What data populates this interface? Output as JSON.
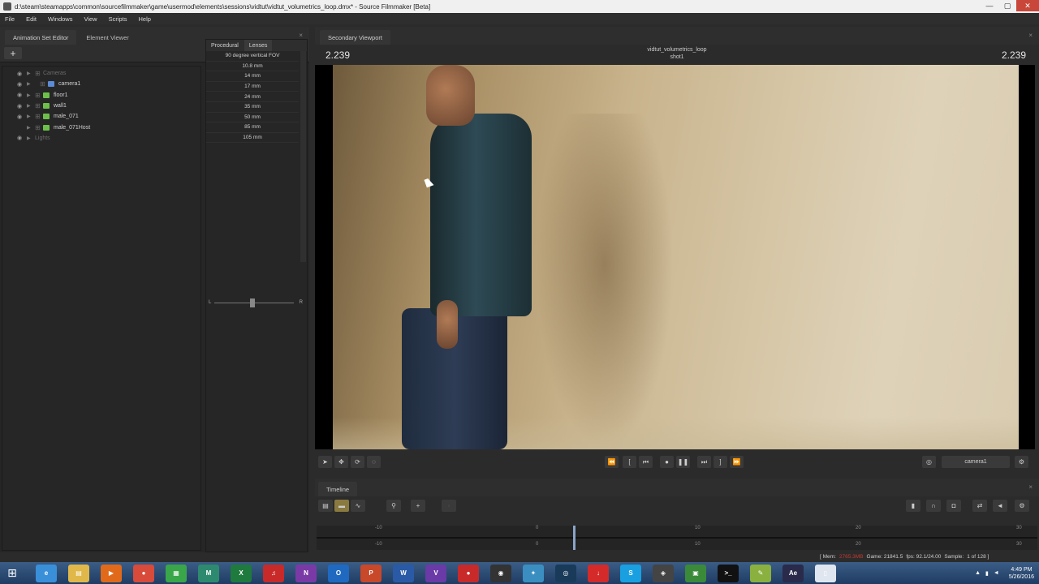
{
  "window": {
    "title": "d:\\steam\\steamapps\\common\\sourcefilmmaker\\game\\usermod\\elements\\sessions\\vidtut\\vidtut_volumetrics_loop.dmx* - Source Filmmaker [Beta]",
    "minimize": "—",
    "maximize": "▢",
    "close": "✕"
  },
  "menu": [
    "File",
    "Edit",
    "Windows",
    "View",
    "Scripts",
    "Help"
  ],
  "left_panel": {
    "tabs": [
      "Animation Set Editor",
      "Element Viewer"
    ],
    "close_glyph": "×",
    "add_label": "+",
    "gear_glyph": "⚙",
    "tree": [
      {
        "label": "Cameras",
        "icon": "none",
        "dim": true
      },
      {
        "label": "camera1",
        "icon": "camera",
        "dim": false
      },
      {
        "label": "floor1",
        "icon": "model",
        "dim": false
      },
      {
        "label": "wall1",
        "icon": "model",
        "dim": false
      },
      {
        "label": "male_071",
        "icon": "model",
        "dim": false
      },
      {
        "label": "male_071Host",
        "icon": "model",
        "dim": false
      },
      {
        "label": "Lights",
        "icon": "none",
        "dim": true
      }
    ],
    "lens_tabs": [
      "Procedural",
      "Lenses"
    ],
    "lenses": [
      "90 degree vertical FOV",
      "10.8 mm",
      "14 mm",
      "17 mm",
      "24 mm",
      "35 mm",
      "50 mm",
      "85 mm",
      "105 mm"
    ],
    "slider_left": "L",
    "slider_right": "R"
  },
  "viewport": {
    "tab": "Secondary Viewport",
    "close_glyph": "×",
    "frame_left": "2.239",
    "frame_right": "2.239",
    "session_name": "vidtut_volumetrics_loop",
    "shot_name": "shot1",
    "camera_select": "camera1"
  },
  "timeline": {
    "tab": "Timeline",
    "ticks_top": [
      "-10",
      "0",
      "10",
      "20",
      "30"
    ],
    "ticks_bottom": [
      "-10",
      "0",
      "10",
      "20",
      "30"
    ]
  },
  "status": {
    "mem_label": "[ Mem:",
    "mem_value": "2765.3MB",
    "game": "Game: 21841.5",
    "fps": "fps: 92.1/24.00",
    "sample": "Sample:",
    "sample_value": "1 of 128 ]"
  },
  "taskbar": {
    "time": "4:49 PM",
    "date": "5/26/2016",
    "apps": [
      {
        "name": "ie",
        "glyph": "e",
        "color": "#3a8fd9"
      },
      {
        "name": "explorer",
        "glyph": "▤",
        "color": "#e0b84a"
      },
      {
        "name": "media",
        "glyph": "▶",
        "color": "#e06a1a"
      },
      {
        "name": "chrome",
        "glyph": "●",
        "color": "#d84a3a"
      },
      {
        "name": "spreadsheet",
        "glyph": "▦",
        "color": "#3aa64a"
      },
      {
        "name": "maya",
        "glyph": "M",
        "color": "#2e8a6e"
      },
      {
        "name": "excel",
        "glyph": "X",
        "color": "#1f7a3e"
      },
      {
        "name": "mp3",
        "glyph": "♫",
        "color": "#c82a2a"
      },
      {
        "name": "onenote",
        "glyph": "N",
        "color": "#7a3aa6"
      },
      {
        "name": "outlook",
        "glyph": "O",
        "color": "#1f6ac0"
      },
      {
        "name": "powerpoint",
        "glyph": "P",
        "color": "#c8482a"
      },
      {
        "name": "word",
        "glyph": "W",
        "color": "#2a5aa6"
      },
      {
        "name": "visualstudio",
        "glyph": "V",
        "color": "#6a3aa6"
      },
      {
        "name": "recorder",
        "glyph": "●",
        "color": "#c82a2a"
      },
      {
        "name": "steam-alt",
        "glyph": "◉",
        "color": "#333"
      },
      {
        "name": "tool",
        "glyph": "✦",
        "color": "#3a8fc0"
      },
      {
        "name": "steam",
        "glyph": "◎",
        "color": "#1a3a5a"
      },
      {
        "name": "download",
        "glyph": "↓",
        "color": "#d42a2a"
      },
      {
        "name": "skype",
        "glyph": "S",
        "color": "#1aa0e0"
      },
      {
        "name": "game",
        "glyph": "◈",
        "color": "#444"
      },
      {
        "name": "photo",
        "glyph": "▣",
        "color": "#3a8a3a"
      },
      {
        "name": "cmd",
        "glyph": ">_",
        "color": "#111"
      },
      {
        "name": "notes",
        "glyph": "✎",
        "color": "#8ab040"
      },
      {
        "name": "aftereffects",
        "glyph": "Ae",
        "color": "#2a2a4a"
      },
      {
        "name": "file",
        "glyph": "▯",
        "color": "#dfe6ef"
      }
    ]
  }
}
